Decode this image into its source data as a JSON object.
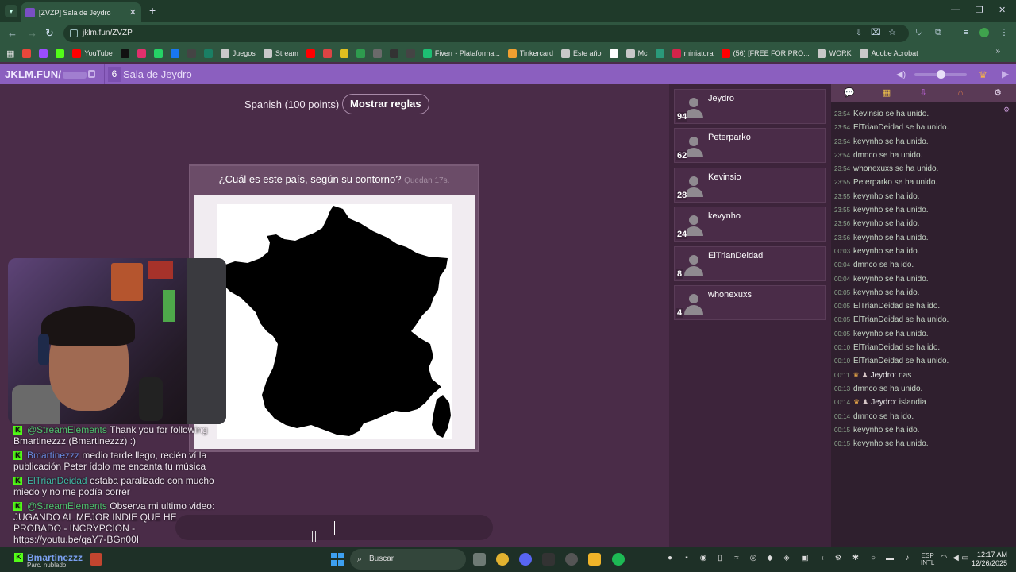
{
  "browser": {
    "tab_title": "[ZVZP] Sala de Jeydro",
    "tab_close": "✕",
    "new_tab": "+",
    "url": "jklm.fun/ZVZP",
    "bookmarks": [
      {
        "label": "",
        "color": "#e9473b"
      },
      {
        "label": "",
        "color": "#9b4dff"
      },
      {
        "label": "",
        "color": "#53fc18"
      },
      {
        "label": "YouTube",
        "color": "#ff0000"
      },
      {
        "label": "",
        "color": "#111111"
      },
      {
        "label": "",
        "color": "#e1306c"
      },
      {
        "label": "",
        "color": "#25d366"
      },
      {
        "label": "",
        "color": "#1877f2"
      },
      {
        "label": "",
        "color": "#444444"
      },
      {
        "label": "",
        "color": "#1a7f64"
      },
      {
        "label": "Juegos",
        "color": "#c9c9c9"
      },
      {
        "label": "Stream",
        "color": "#c9c9c9"
      },
      {
        "label": "",
        "color": "#ff0000"
      },
      {
        "label": "",
        "color": "#d44"
      },
      {
        "label": "",
        "color": "#e0c020"
      },
      {
        "label": "",
        "color": "#2e9b4e"
      },
      {
        "label": "",
        "color": "#6a6a6a"
      },
      {
        "label": "",
        "color": "#333333"
      },
      {
        "label": "",
        "color": "#444444"
      },
      {
        "label": "Fiverr - Plataforma...",
        "color": "#1dbf73"
      },
      {
        "label": "Tinkercard",
        "color": "#f0a030"
      },
      {
        "label": "Este año",
        "color": "#c9c9c9"
      },
      {
        "label": "",
        "color": "#ffffff"
      },
      {
        "label": "Mc",
        "color": "#c9c9c9"
      },
      {
        "label": "",
        "color": "#2a9a7a"
      },
      {
        "label": "miniatura",
        "color": "#d4244a"
      },
      {
        "label": "(56) [FREE FOR PRO...",
        "color": "#ff0000"
      },
      {
        "label": "WORK",
        "color": "#c9c9c9"
      },
      {
        "label": "Adobe Acrobat",
        "color": "#c9c9c9"
      }
    ],
    "more_bookmarks": "»"
  },
  "site": {
    "brand": "JKLM.FUN/",
    "player_count": "6",
    "room_name": "Sala de Jeydro"
  },
  "game": {
    "language": "Spanish (100 points)",
    "rules_button": "Mostrar reglas",
    "question": "¿Cuál es este país, según su contorno?",
    "timer": "Quedan 17s."
  },
  "stream_chat": [
    {
      "user": "@StreamElements",
      "user_color": "u1",
      "text": "Thank you for following Bmartinezzz (Bmartinezzz) :)"
    },
    {
      "user": "Bmartinezzz",
      "user_color": "u2",
      "text": "medio tarde llego, recién ví la publicación Peter ídolo me encanta tu música"
    },
    {
      "user": "ElTrianDeidad",
      "user_color": "u3",
      "text": "estaba paralizado con mucho miedo y no me podía correr"
    },
    {
      "user": "@StreamElements",
      "user_color": "u1",
      "text": "Observa mi ultimo video: JUGANDO AL MEJOR INDIE QUE HE PROBADO - INCRYPCION - https://youtu.be/qaY7-BGn00I"
    }
  ],
  "players": [
    {
      "name": "Jeydro",
      "score": "94"
    },
    {
      "name": "Peterparko",
      "score": "62"
    },
    {
      "name": "Kevinsio",
      "score": "28"
    },
    {
      "name": "kevynho",
      "score": "24"
    },
    {
      "name": "ElTrianDeidad",
      "score": "8"
    },
    {
      "name": "whonexuxs",
      "score": "4"
    }
  ],
  "feed": [
    {
      "time": "23:54",
      "text": "Kevinsio se ha unido."
    },
    {
      "time": "23:54",
      "text": "ElTrianDeidad  se ha unido."
    },
    {
      "time": "23:54",
      "text": "kevynho se ha unido."
    },
    {
      "time": "23:54",
      "text": "dmnco se ha unido."
    },
    {
      "time": "23:54",
      "text": "whonexuxs se ha unido."
    },
    {
      "time": "23:55",
      "text": "Peterparko se ha unido."
    },
    {
      "time": "23:55",
      "text": "kevynho se ha ido."
    },
    {
      "time": "23:55",
      "text": "kevynho se ha unido."
    },
    {
      "time": "23:56",
      "text": "kevynho se ha ido."
    },
    {
      "time": "23:56",
      "text": "kevynho se ha unido."
    },
    {
      "time": "00:03",
      "text": "kevynho se ha ido."
    },
    {
      "time": "00:04",
      "text": "dmnco se ha ido."
    },
    {
      "time": "00:04",
      "text": "kevynho se ha unido."
    },
    {
      "time": "00:05",
      "text": "kevynho se ha ido."
    },
    {
      "time": "00:05",
      "text": "ElTrianDeidad  se ha ido."
    },
    {
      "time": "00:05",
      "text": "ElTrianDeidad  se ha unido."
    },
    {
      "time": "00:05",
      "text": "kevynho se ha unido."
    },
    {
      "time": "00:10",
      "text": "ElTrianDeidad  se ha ido."
    },
    {
      "time": "00:10",
      "text": "ElTrianDeidad  se ha unido."
    },
    {
      "time": "00:11",
      "chat": true,
      "name": "Jeydro:",
      "text": "nas"
    },
    {
      "time": "00:13",
      "text": "dmnco se ha unido."
    },
    {
      "time": "00:14",
      "chat": true,
      "name": "Jeydro:",
      "text": "islandia"
    },
    {
      "time": "00:14",
      "text": "dmnco se ha ido."
    },
    {
      "time": "00:15",
      "text": "kevynho se ha ido."
    },
    {
      "time": "00:15",
      "text": "kevynho se ha unido."
    }
  ],
  "taskbar": {
    "weather_user": "Bmartinezzz",
    "weather_sub": "Parc. nublado",
    "search": "Buscar",
    "lang_top": "ESP",
    "lang_bottom": "INTL",
    "time": "12:17 AM",
    "date": "12/26/2025"
  }
}
